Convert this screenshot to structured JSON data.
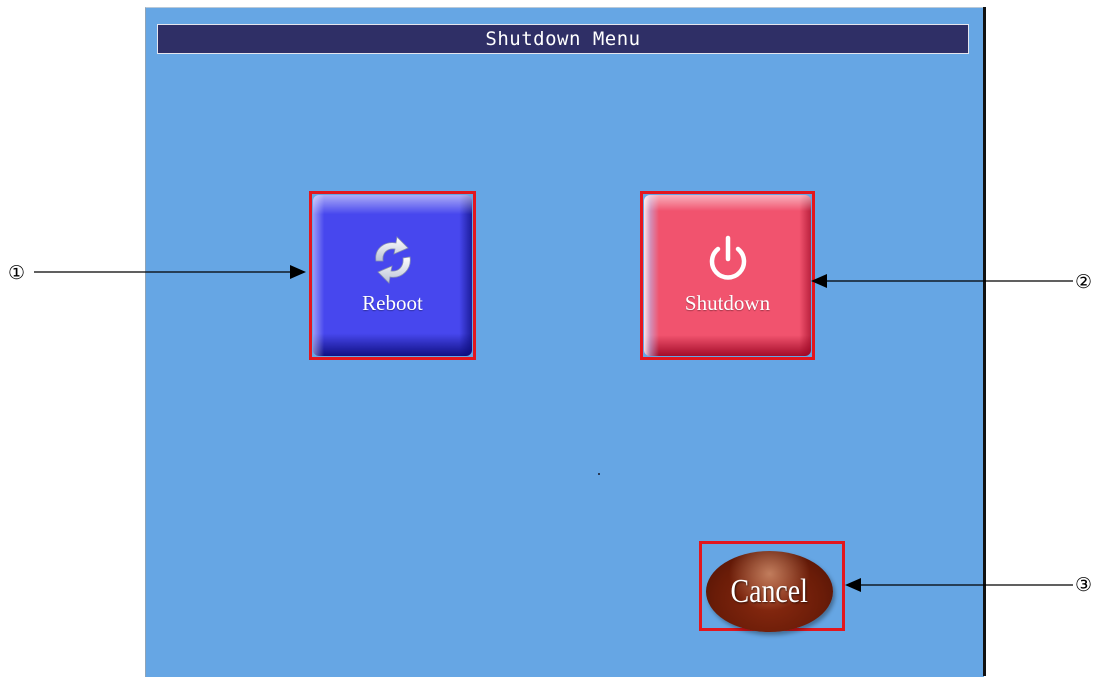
{
  "window": {
    "title": "Shutdown Menu"
  },
  "buttons": {
    "reboot": {
      "label": "Reboot",
      "icon": "refresh-icon",
      "color": "#4747ee"
    },
    "shutdown": {
      "label": "Shutdown",
      "icon": "power-icon",
      "color": "#f1536e"
    },
    "cancel": {
      "label": "Cancel",
      "color": "#6a1c08"
    }
  },
  "callouts": [
    {
      "number": "①",
      "target": "reboot"
    },
    {
      "number": "②",
      "target": "shutdown"
    },
    {
      "number": "③",
      "target": "cancel"
    }
  ],
  "colors": {
    "panel_background": "#66a6e4",
    "title_bar": "#2f2f66",
    "highlight": "#e3161e"
  }
}
